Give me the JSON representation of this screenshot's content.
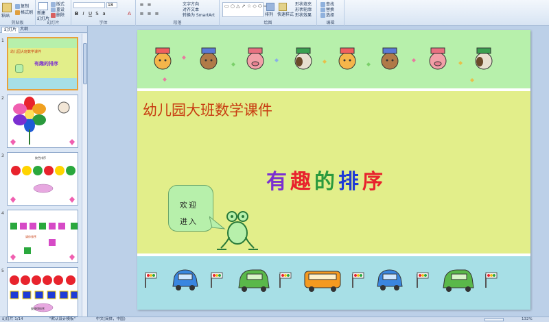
{
  "ribbon": {
    "groups": {
      "clipboard": "剪贴板",
      "slides": "幻灯片",
      "font": "字体",
      "paragraph": "段落",
      "drawing": "绘图",
      "editing": "编辑"
    },
    "paste": "粘贴",
    "copy": "复制",
    "format_painter": "格式刷",
    "new_slide": "新建\n幻灯片",
    "layout": "版式",
    "reset": "重设",
    "delete": "删除",
    "text_direction": "文字方向",
    "align_text": "对齐文本",
    "smartart": "转换为 SmartArt",
    "arrange": "排列",
    "quick_styles": "快速样式",
    "shape_fill": "形状填充",
    "shape_outline": "形状轮廓",
    "shape_effects": "形状效果",
    "find": "查找",
    "replace": "替换",
    "select": "选择",
    "font_size": "18"
  },
  "panel": {
    "tab_slides": "幻灯片",
    "tab_outline": "大纲",
    "thumb1_title": "幼儿园大班数学课件",
    "thumb1_fun": "有趣的排序",
    "thumb3_caption": "按色排序",
    "thumb4_caption": "请你排序",
    "thumb5_caption": "按规律排序"
  },
  "slide": {
    "title": "幼儿园大班数学课件",
    "fun_chars": [
      "有",
      "趣",
      "的",
      "排",
      "序"
    ],
    "fun_colors": [
      "#7b2fd1",
      "#e8232d",
      "#2a9a3d",
      "#1f3bd6",
      "#e8232d"
    ],
    "welcome_line1": "欢迎",
    "welcome_line2": "进入"
  },
  "status": {
    "slide_counter": "幻灯片 1/14",
    "theme": "\"默认设计模板\"",
    "language": "中文(简体，中国)",
    "zoom": "132%"
  }
}
